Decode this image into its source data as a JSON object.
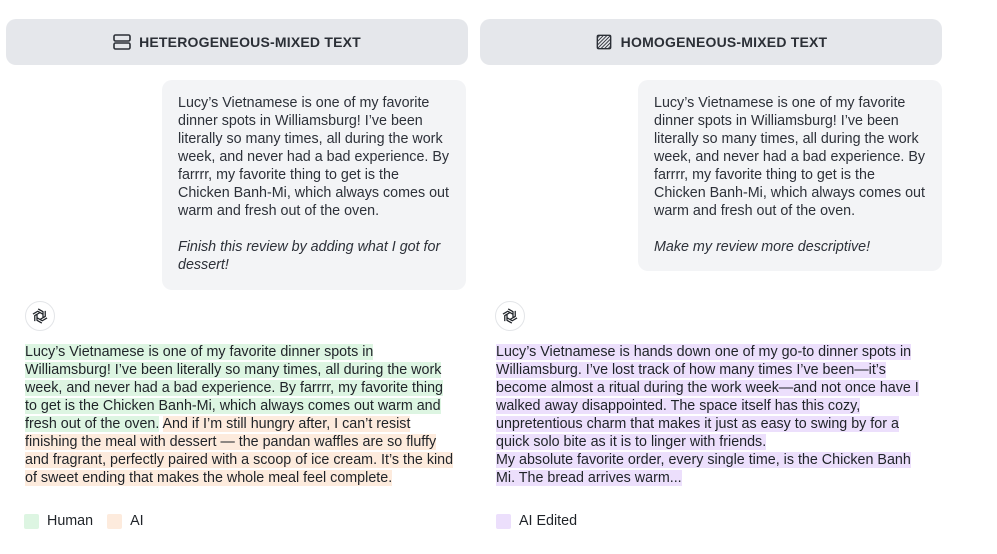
{
  "left": {
    "header": {
      "label": "HETEROGENEOUS-MIXED TEXT",
      "icon": "stacked-rows-icon"
    },
    "bubble": {
      "text": "Lucy’s Vietnamese is one of my favorite dinner spots in Williamsburg! I’ve been literally so many times, all during the work week, and never had a bad experience. By farrrr, my favorite thing to get is the Chicken Banh-Mi, which always comes out warm and fresh out of the oven.",
      "prompt": "Finish this review by adding what I got for dessert!"
    },
    "response": {
      "human": "Lucy’s Vietnamese is one of my favorite dinner spots in Williamsburg! I’ve been literally so many times, all during the work week, and never had a bad experience. By farrrr, my favorite thing to get is the Chicken Banh-Mi, which always comes out warm and fresh out of the oven.",
      "ai": "And if I’m still hungry after, I can’t resist finishing the meal with dessert — the pandan waffles are so fluffy and fragrant, perfectly paired with a scoop of ice cream. It’s the kind of sweet ending that makes the whole meal feel complete."
    },
    "legend": {
      "human": "Human",
      "ai": "AI"
    }
  },
  "right": {
    "header": {
      "label": "HOMOGENEOUS-MIXED TEXT",
      "icon": "hatched-square-icon"
    },
    "bubble": {
      "text": "Lucy’s Vietnamese is one of my favorite dinner spots in Williamsburg! I’ve been literally so many times, all during the work week, and never had a bad experience. By farrrr, my favorite thing to get is the Chicken Banh-Mi, which always comes out warm and fresh out of the oven.",
      "prompt": "Make my review more descriptive!"
    },
    "response": {
      "para1": "Lucy’s Vietnamese is hands down one of my go-to dinner spots in Williamsburg. I’ve lost track of how many times I’ve been—it’s become almost a ritual during the work week—and not once have I walked away disappointed. The space itself has this cozy, unpretentious charm that makes it just as easy to swing by for a quick solo bite as it is to linger with friends.",
      "para2": "My absolute favorite order, every single time, is the Chicken Banh Mi. The bread arrives warm..."
    },
    "legend": {
      "edited": "AI Edited"
    }
  },
  "colors": {
    "human": "#ddf5e2",
    "ai": "#fdebdd",
    "ai_edited": "#ecdffc",
    "header_bg": "#e5e7eb",
    "bubble_bg": "#f3f4f6"
  },
  "avatar_icon": "chatgpt-logo-icon"
}
